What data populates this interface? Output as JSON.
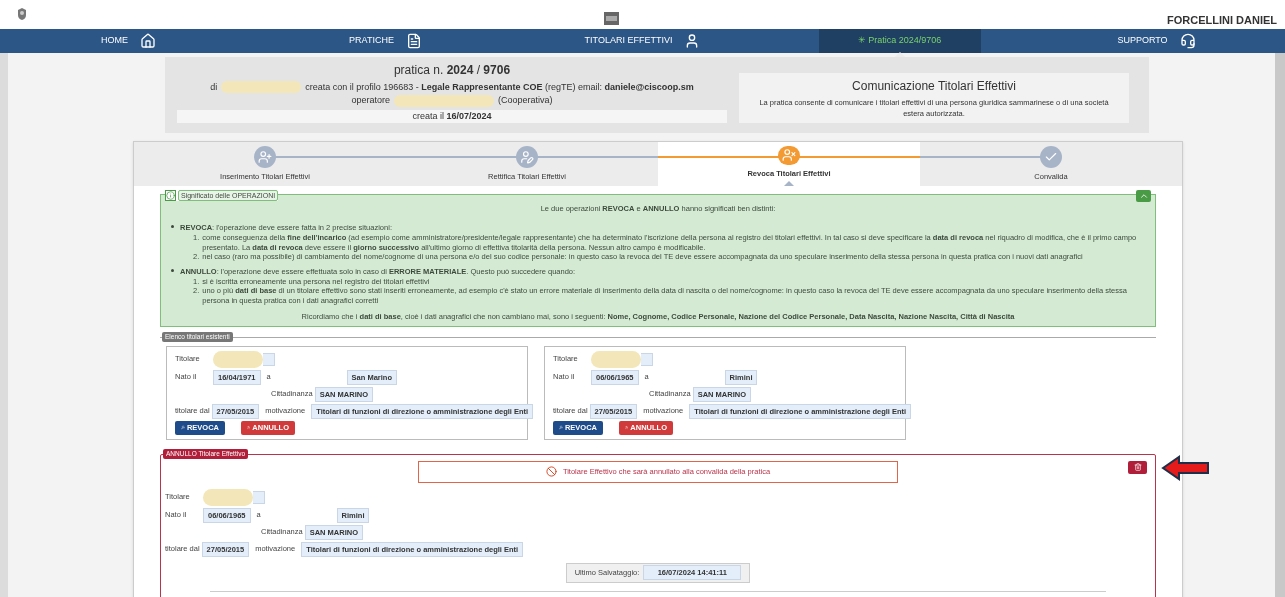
{
  "top_bar": {
    "user": "FORCELLINI DANIEL"
  },
  "nav": [
    {
      "label": "HOME",
      "selected": false
    },
    {
      "label": "PRATICHE",
      "selected": false
    },
    {
      "label": "TITOLARI EFFETTIVI",
      "selected": false
    },
    {
      "label": "✳ Pratica 2024/9706",
      "selected": true
    },
    {
      "label": "SUPPORTO",
      "selected": false
    }
  ],
  "header": {
    "title": "pratica n. **2024** / **9706**",
    "by_prefix": "di",
    "by_rest": "creata con il profilo 196683 - **Legale Rappresentante COE** (regTE)  email: **daniele@ciscoop.sm**",
    "operator_prefix": "operatore",
    "operator_rest": "(Cooperativa)",
    "created": "creata il **16/07/2024**",
    "side_title": "Comunicazione Titolari Effettivi",
    "side_text": "La pratica consente di comunicare i titolari effettivi di una persona giuridica sammarinese o di una società estera autorizzata."
  },
  "steps": [
    {
      "label": "Inserimento Titolari Effettivi",
      "selected": false
    },
    {
      "label": "Rettifica Titolari Effettivi",
      "selected": false
    },
    {
      "label": "Revoca Titolari Effettivi",
      "selected": true
    },
    {
      "label": "Convalida",
      "selected": false
    }
  ],
  "info": {
    "title": "Significato delle OPERAZIONI",
    "expanded": true,
    "intro": "Le due operazioni **REVOCA** e **ANNULLO** hanno significati ben distinti:",
    "items": [
      {
        "text": "**REVOCA**: l'operazione deve essere fatta in 2 precise situazioni:",
        "children": [
          {
            "number": "1.",
            "text": "come conseguenza della **fine dell'incarico** (ad esempio come amministratore/presidente/legale rappresentante) che ha determinato l'iscrizione della persona al registro dei titolari effettivi. In tal caso si deve specificare la **data di revoca** nel riquadro di modifica, che è il primo campo presentato. La **data di revoca** deve essere il **giorno successivo** all'ultimo giorno di effettiva titolarità della persona. Nessun altro campo è modificabile."
          },
          {
            "number": "2.",
            "text": "nel caso (raro ma possibile) di cambiamento del nome/cognome di una persona e/o del suo codice personale: in questo caso la revoca del TE deve essere accompagnata da uno speculare inserimento della stessa persona in questa pratica con i nuovi dati anagrafici"
          }
        ]
      },
      {
        "text": "**ANNULLO**: l'operazione deve essere effettuata solo in caso di **ERRORE MATERIALE**. Questo può succedere quando:",
        "children": [
          {
            "number": "1.",
            "text": "si è iscritta erroneamente una persona nel registro dei titolari effettivi"
          },
          {
            "number": "2.",
            "text": "uno o più **dati di base** di un titolare effettivo sono stati inseriti erroneamente, ad esempio c'è stato un errore materiale di inserimento della data di nascita o del nome/cognome: in questo caso la revoca del TE deve essere accompagnata da uno speculare inserimento della stessa persona in questa pratica con i dati anagrafici corretti"
          }
        ]
      }
    ],
    "footer": "Ricordiamo che i **dati di base**, cioè i dati anagrafici che non cambiano mai, sono i seguenti: **Nome, Cognome, Codice Personale, Nazione del Codice Personale, Data Nascita, Nazione Nascita, Città di Nascita**"
  },
  "existing": {
    "legend": "Elenco titolari esistenti",
    "cards": [
      {
        "labels": {
          "holder": "Titolare",
          "born": "Nato il",
          "at": "a",
          "citizenship": "Cittadinanza",
          "since": "titolare dal",
          "reason": "motivazione"
        },
        "born_date": "16/04/1971",
        "place": "San Marino",
        "citizenship": "SAN MARINO",
        "since": "27/05/2015",
        "reason": "Titolari di funzioni di direzione o amministrazione degli Enti",
        "buttons": [
          "REVOCA",
          "ANNULLO"
        ]
      },
      {
        "labels": {
          "holder": "Titolare",
          "born": "Nato il",
          "at": "a",
          "citizenship": "Cittadinanza",
          "since": "titolare dal",
          "reason": "motivazione"
        },
        "born_date": "06/06/1965",
        "place": "Rimini",
        "citizenship": "SAN MARINO",
        "since": "27/05/2015",
        "reason": "Titolari di funzioni di direzione o amministrazione degli Enti",
        "buttons": [
          "REVOCA",
          "ANNULLO"
        ]
      }
    ]
  },
  "annullo": {
    "legend": "ANNULLO Titolare Effettivo",
    "notice": "Titolare Effettivo che sarà annullato alla convalida della pratica",
    "person": {
      "labels": {
        "holder": "Titolare",
        "born": "Nato il",
        "at": "a",
        "citizenship": "Cittadinanza",
        "since": "titolare dal",
        "reason": "motivazione"
      },
      "born_date": "06/06/1965",
      "place": "Rimini",
      "citizenship": "SAN MARINO",
      "since": "27/05/2015",
      "reason": "Titolari di funzioni di direzione o amministrazione degli Enti"
    },
    "last_save_label": "Ultimo Salvataggio:",
    "last_save": "16/07/2024 14:41:11"
  }
}
